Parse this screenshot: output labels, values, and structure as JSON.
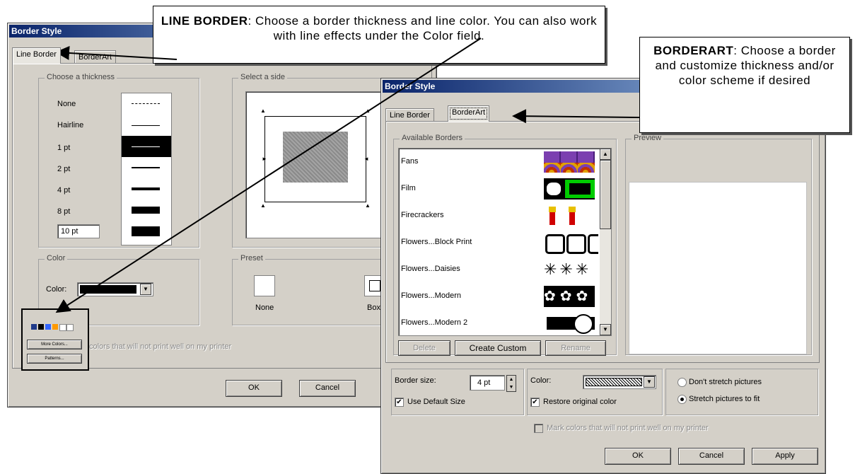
{
  "dialog1": {
    "title": "Border Style",
    "tabs": [
      "Line Border",
      "BorderArt"
    ],
    "thickness": {
      "legend": "Choose a thickness",
      "options": [
        "None",
        "Hairline",
        "1 pt",
        "2 pt",
        "4 pt",
        "8 pt"
      ],
      "custom_value": "10 pt"
    },
    "side": {
      "legend": "Select a side"
    },
    "color": {
      "legend": "Color",
      "label": "Color:"
    },
    "preset": {
      "legend": "Preset",
      "options": [
        "None",
        "Box"
      ]
    },
    "mark_colors_text": "colors that will not print well on my printer",
    "popup": {
      "more_colors": "More Colors...",
      "patterns": "Patterns..."
    },
    "buttons": {
      "ok": "OK",
      "cancel": "Cancel"
    }
  },
  "dialog2": {
    "title": "Border Style",
    "tabs": [
      "Line Border",
      "BorderArt"
    ],
    "available_borders": {
      "legend": "Available Borders",
      "items": [
        "Fans",
        "Film",
        "Firecrackers",
        "Flowers...Block Print",
        "Flowers...Daisies",
        "Flowers...Modern",
        "Flowers...Modern 2"
      ]
    },
    "preview": {
      "legend": "Preview"
    },
    "buttons_row": {
      "delete": "Delete",
      "create_custom": "Create Custom",
      "rename": "Rename"
    },
    "border_size": {
      "label": "Border size:",
      "value": "4 pt"
    },
    "use_default_size": "Use Default Size",
    "color": {
      "label": "Color:"
    },
    "restore_original_color": "Restore original color",
    "stretch": {
      "dont": "Don't stretch pictures",
      "fit": "Stretch pictures to fit",
      "selected": "fit"
    },
    "mark_colors_text": "Mark colors that will not print well on my printer",
    "buttons": {
      "ok": "OK",
      "cancel": "Cancel",
      "apply": "Apply"
    }
  },
  "callouts": {
    "line_border": {
      "heading": "LINE BORDER",
      "text": ": Choose a border thickness and line color. You can also work with line effects under the Color field."
    },
    "borderart": {
      "heading": "BORDERART",
      "text": ": Choose a border and customize thickness and/or color scheme if desired"
    }
  }
}
